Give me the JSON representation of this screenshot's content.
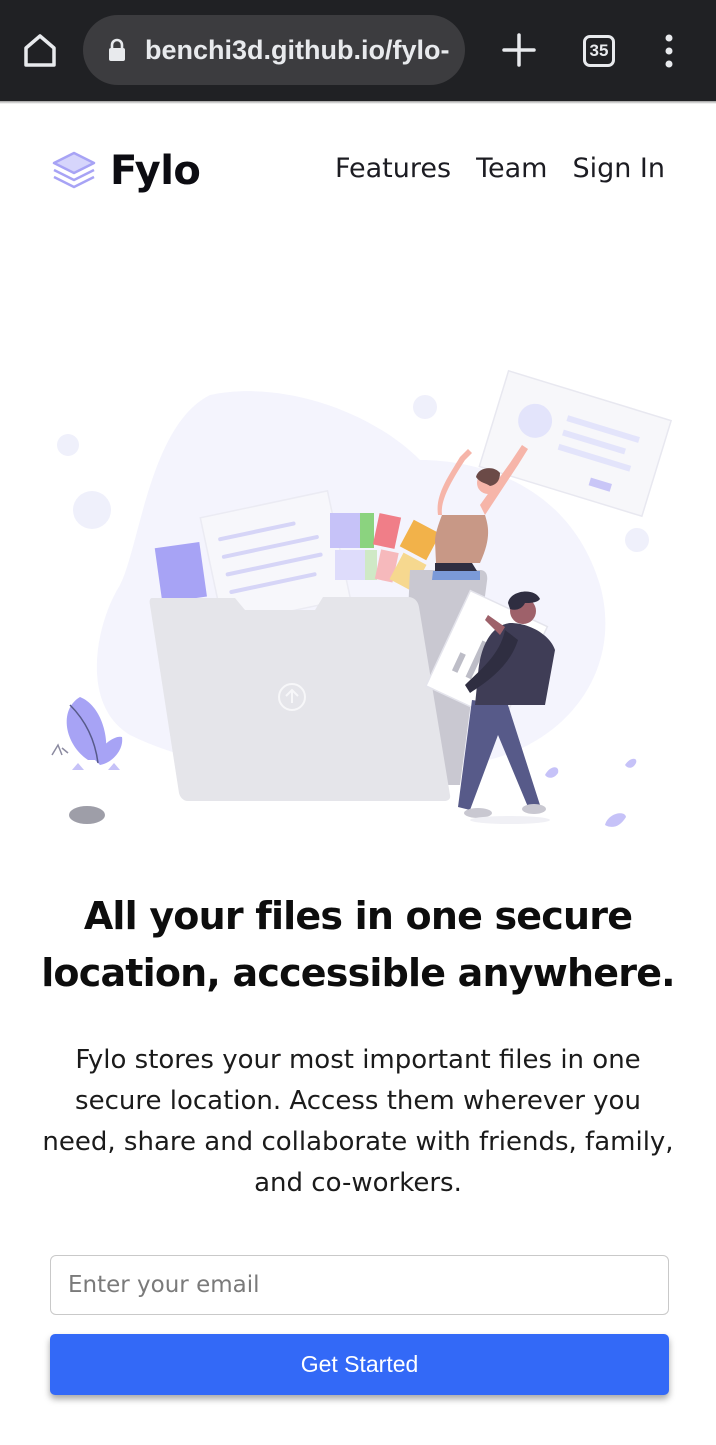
{
  "browser": {
    "url": "benchi3d.github.io/fylo-",
    "tab_count": "35",
    "icons": [
      "home-icon",
      "lock-icon",
      "new-tab-icon",
      "tab-switcher-icon",
      "overflow-menu-icon"
    ]
  },
  "header": {
    "brand": "Fylo",
    "nav": [
      "Features",
      "Team",
      "Sign In"
    ]
  },
  "hero": {
    "title": "All your files in one secure location, accessible anywhere.",
    "description": "Fylo stores your most important files in one secure location. Access them wherever you need, share and collaborate with friends, family, and co-workers."
  },
  "signup": {
    "email_placeholder": "Enter your email",
    "email_value": "",
    "button_label": "Get Started"
  },
  "colors": {
    "accent": "#3369f7",
    "illustration_purple": "#a7a3f5",
    "chrome_bg": "#202124"
  }
}
